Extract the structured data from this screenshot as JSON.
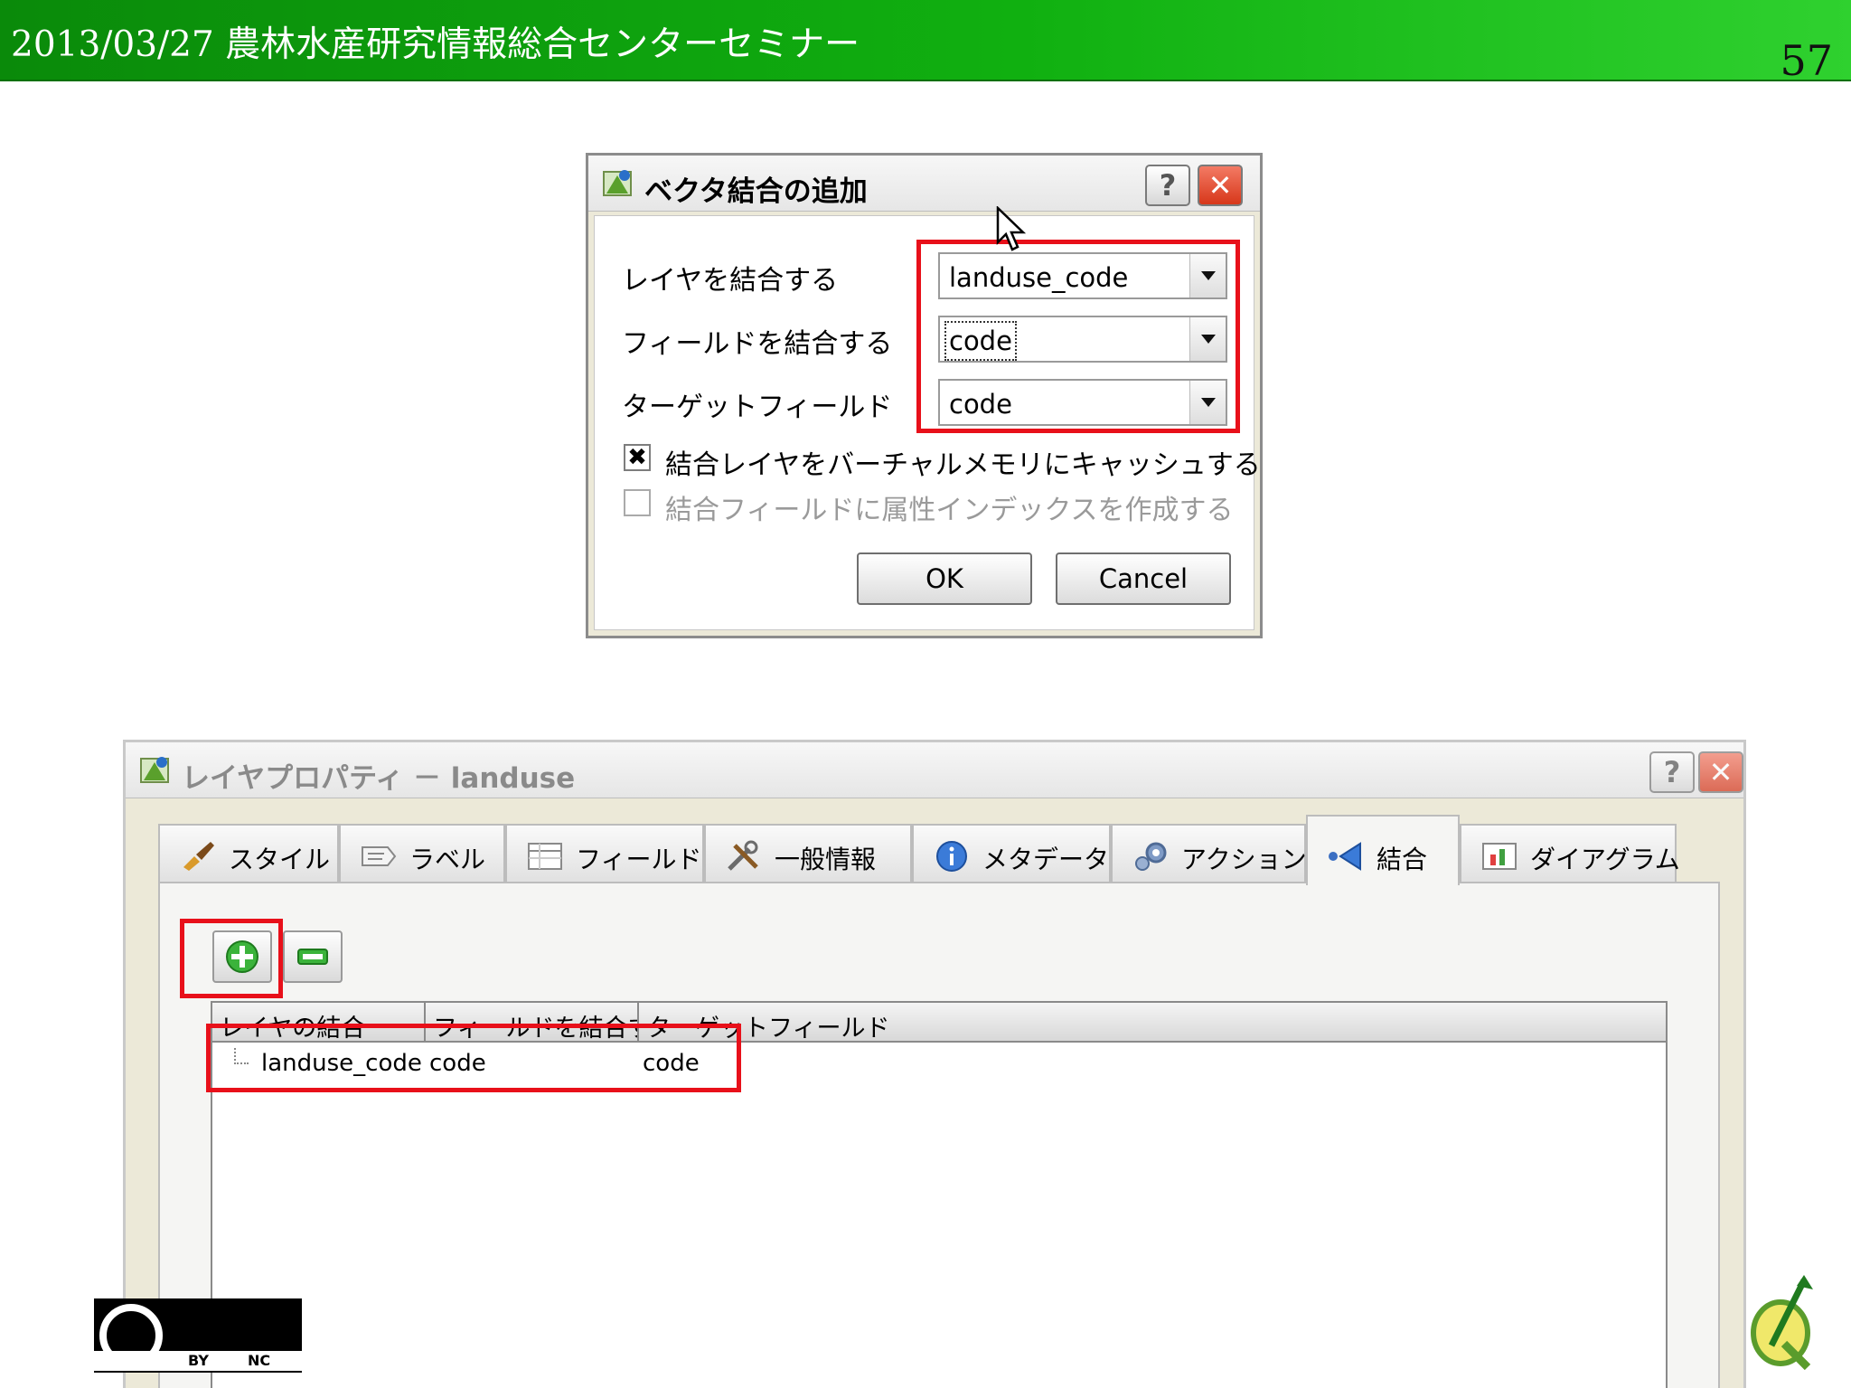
{
  "slide": {
    "title": "2013/03/27 農林水産研究情報総合センターセミナー",
    "page_number": "57",
    "header_color": "#10b010"
  },
  "add_join_dialog": {
    "title": "ベクタ結合の追加",
    "help_label": "?",
    "close_label": "✕",
    "rows": [
      {
        "label": "レイヤを結合する",
        "value": "landuse_code"
      },
      {
        "label": "フィールドを結合する",
        "value": "code"
      },
      {
        "label": "ターゲットフィールド",
        "value": "code"
      }
    ],
    "checkboxes": [
      {
        "label": "結合レイヤをバーチャルメモリにキャッシュする",
        "checked": true,
        "mark": "✖"
      },
      {
        "label": "結合フィールドに属性インデックスを作成する",
        "checked": false,
        "mark": ""
      }
    ],
    "ok_label": "OK",
    "cancel_label": "Cancel"
  },
  "layer_properties": {
    "title": "レイヤプロパティ － landuse",
    "help_label": "?",
    "close_label": "✕",
    "tabs": [
      {
        "label": "スタイル",
        "icon": "brush-icon"
      },
      {
        "label": "ラベル",
        "icon": "label-icon"
      },
      {
        "label": "フィールド",
        "icon": "table-icon"
      },
      {
        "label": "一般情報",
        "icon": "tools-icon"
      },
      {
        "label": "メタデータ",
        "icon": "info-icon"
      },
      {
        "label": "アクション",
        "icon": "gear-icon"
      },
      {
        "label": "結合",
        "icon": "join-icon",
        "active": true
      },
      {
        "label": "ダイアグラム",
        "icon": "diagram-icon"
      }
    ],
    "join_table": {
      "columns": [
        "レイヤの結合",
        "フィールドを結合する",
        "ターゲットフィールド"
      ],
      "rows": [
        [
          "landuse_code",
          "code",
          "code"
        ]
      ]
    }
  },
  "footer": {
    "cc_by": "BY",
    "cc_nc": "NC"
  },
  "colors": {
    "highlight": "#e8101a",
    "accent_green": "#1fa31f"
  }
}
